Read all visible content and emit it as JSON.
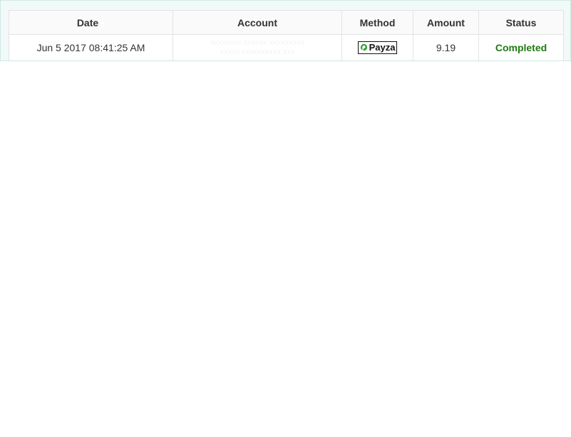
{
  "table": {
    "headers": {
      "date": "Date",
      "account": "Account",
      "method": "Method",
      "amount": "Amount",
      "status": "Status"
    },
    "rows": [
      {
        "date": "Jun 5 2017 08:41:25 AM",
        "account_line1": "xxxxxxxx xxxxxx xxxxxxxxx",
        "account_line2": "xxxxx xxxxxxxxxx xxx",
        "method": "Payza",
        "amount": "9.19",
        "status": "Completed"
      }
    ]
  },
  "colors": {
    "status_completed": "#1f7a12",
    "panel_bg": "#f1faf8",
    "payza_green": "#2f9e2f"
  },
  "icons": {
    "sort": "sort-arrow-icon",
    "method": "payza-logo-icon"
  }
}
